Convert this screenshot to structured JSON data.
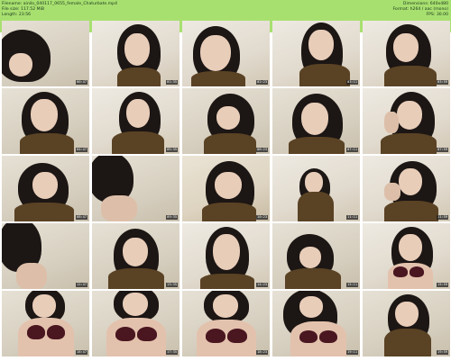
{
  "header": {
    "filename_line": "Filename: ainilo_040117_0655_female_Chaturbate.mp4",
    "filesize_line": "File size: 117.52 MiB",
    "length_line": "Length: 23:56",
    "dimensions_line": "Dimensions: 640x480",
    "format_line": "Format: h264 / aac (mono)",
    "fps_line": "FPS: 30.00",
    "background_color": "#a8e070"
  },
  "thumbnails": [
    {
      "time": "00:47"
    },
    {
      "time": "01:35"
    },
    {
      "time": "02:23"
    },
    {
      "time": "03:11"
    },
    {
      "time": "03:59"
    },
    {
      "time": "04:47"
    },
    {
      "time": "05:35"
    },
    {
      "time": "06:23"
    },
    {
      "time": "07:11"
    },
    {
      "time": "07:59"
    },
    {
      "time": "08:47"
    },
    {
      "time": "09:35"
    },
    {
      "time": "10:23"
    },
    {
      "time": "11:11"
    },
    {
      "time": "11:59"
    },
    {
      "time": "12:47"
    },
    {
      "time": "13:35"
    },
    {
      "time": "14:23"
    },
    {
      "time": "15:11"
    },
    {
      "time": "15:59"
    },
    {
      "time": "16:47"
    },
    {
      "time": "17:35"
    },
    {
      "time": "18:23"
    },
    {
      "time": "19:11"
    },
    {
      "time": "19:59"
    }
  ]
}
